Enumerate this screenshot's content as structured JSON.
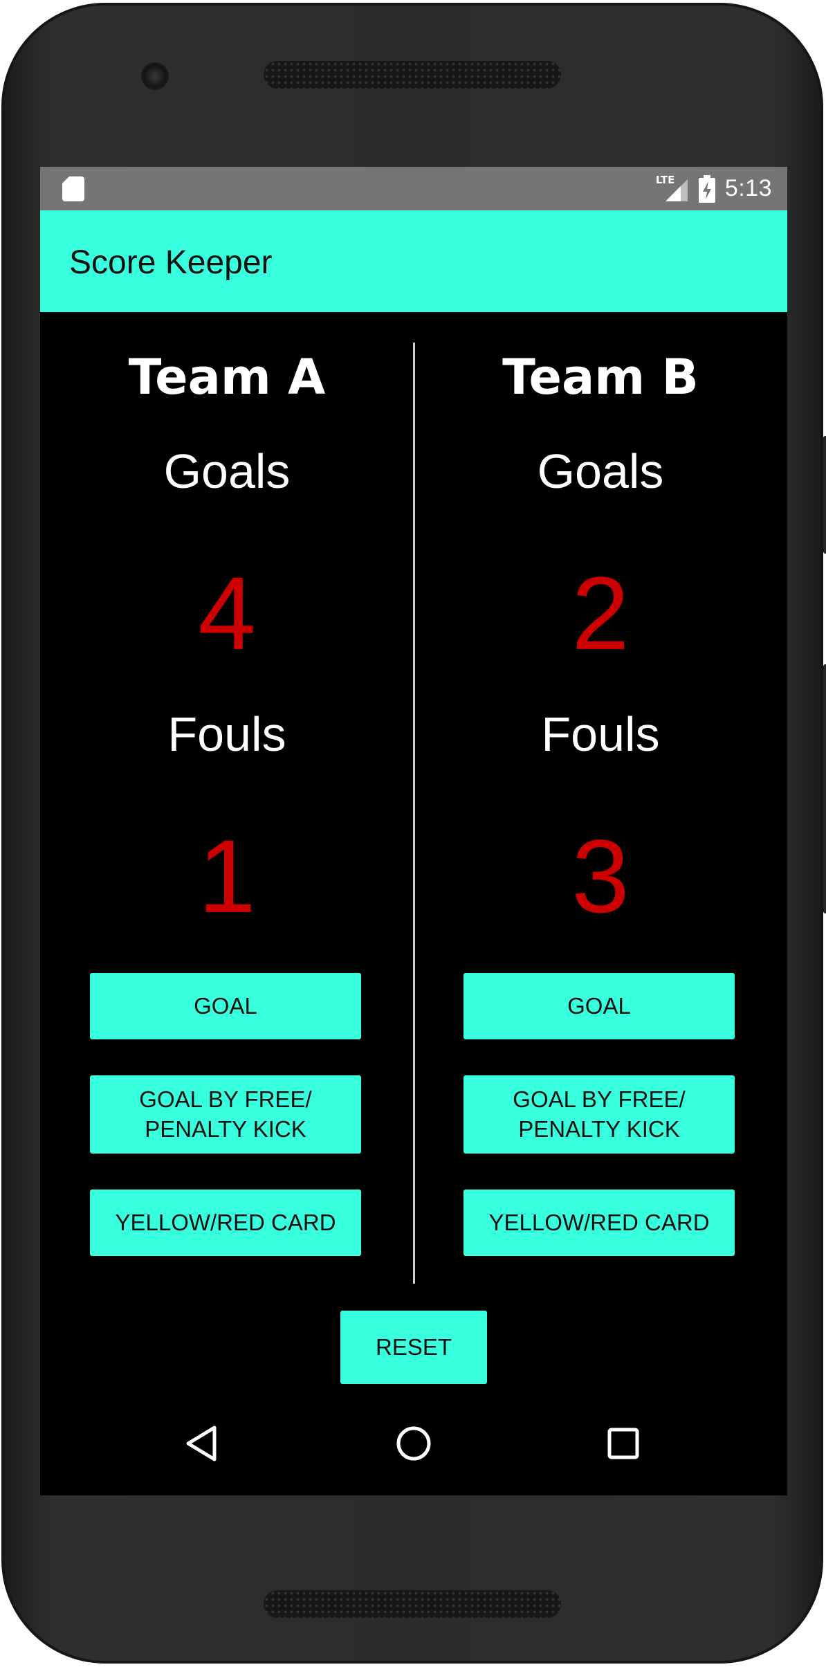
{
  "status_bar": {
    "network": "LTE",
    "time": "5:13"
  },
  "app_bar": {
    "title": "Score Keeper"
  },
  "team_a": {
    "name": "Team A",
    "goals_label": "Goals",
    "goals": "4",
    "fouls_label": "Fouls",
    "fouls": "1",
    "buttons": {
      "goal": "GOAL",
      "free_kick_line1": "GOAL BY FREE/",
      "free_kick_line2": "PENALTY KICK",
      "card": "YELLOW/RED CARD"
    }
  },
  "team_b": {
    "name": "Team B",
    "goals_label": "Goals",
    "goals": "2",
    "fouls_label": "Fouls",
    "fouls": "3",
    "buttons": {
      "goal": "GOAL",
      "free_kick_line1": "GOAL BY FREE/",
      "free_kick_line2": "PENALTY KICK",
      "card": "YELLOW/RED CARD"
    }
  },
  "reset_label": "RESET",
  "nav_bar": {
    "icons": [
      "back-icon",
      "home-icon",
      "recent-apps-icon"
    ]
  },
  "colors": {
    "accent": "#38ffdd",
    "score": "#cc0000",
    "background": "#000000",
    "status_bar": "#757575"
  }
}
